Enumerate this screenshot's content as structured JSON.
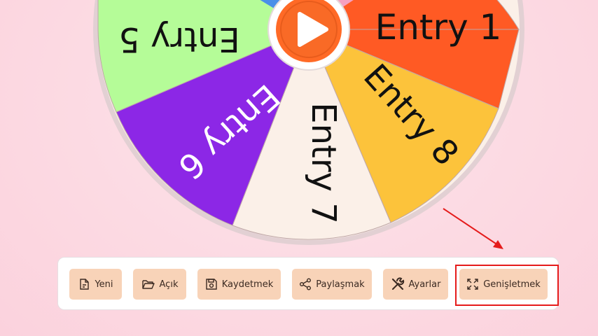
{
  "wheel": {
    "entries": [
      {
        "label": "Entry 1",
        "color": "#ff5a24",
        "text_color": "#111111"
      },
      {
        "label": "Entry 8",
        "color": "#fcc33b",
        "text_color": "#111111"
      },
      {
        "label": "Entry 7",
        "color": "#fbf0e8",
        "text_color": "#111111"
      },
      {
        "label": "Entry 6",
        "color": "#8c27e6",
        "text_color": "#ffffff"
      },
      {
        "label": "Entry 5",
        "color": "#b5fc98",
        "text_color": "#111111"
      }
    ],
    "top_left_color": "#4a8fe8",
    "top_right_color": "#f5a0c0",
    "spin_icon": "play-icon"
  },
  "toolbar": {
    "buttons": [
      {
        "label": "Yeni",
        "icon": "file-icon"
      },
      {
        "label": "Açık",
        "icon": "folder-open-icon"
      },
      {
        "label": "Kaydetmek",
        "icon": "save-icon"
      },
      {
        "label": "Paylaşmak",
        "icon": "share-icon"
      },
      {
        "label": "Ayarlar",
        "icon": "tools-icon"
      },
      {
        "label": "Genişletmek",
        "icon": "expand-icon"
      }
    ]
  },
  "annotation_color": "#e51b1b"
}
